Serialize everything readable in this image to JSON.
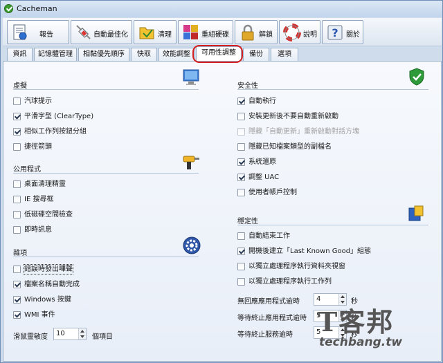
{
  "window": {
    "title": "Cacheman"
  },
  "toolbar": [
    {
      "label": "報告",
      "icon": "report-icon"
    },
    {
      "label": "自動最佳化",
      "icon": "syringe-icon"
    },
    {
      "label": "清理",
      "icon": "cleanup-icon"
    },
    {
      "label": "重組硬碟",
      "icon": "defrag-icon"
    },
    {
      "label": "解鎖",
      "icon": "padlock-icon"
    },
    {
      "label": "說明",
      "icon": "lifebuoy-icon"
    },
    {
      "label": "關於",
      "icon": "question-icon"
    }
  ],
  "tabs": [
    "資訊",
    "記憶體管理",
    "相黏優先順序",
    "快取",
    "效能調整",
    "可用性調整",
    "備份",
    "選項"
  ],
  "active_tab": "可用性調整",
  "left": {
    "appearance": {
      "title": "虛擬",
      "options": [
        {
          "label": "汽球提示",
          "checked": false
        },
        {
          "label": "平滑字型 (ClearType)",
          "checked": true
        },
        {
          "label": "相似工作列按鈕分組",
          "checked": true
        },
        {
          "label": "捷徑箭頭",
          "checked": false
        }
      ]
    },
    "utilities": {
      "title": "公用程式",
      "options": [
        {
          "label": "桌面清理精靈",
          "checked": false
        },
        {
          "label": "IE 搜尋框",
          "checked": false
        },
        {
          "label": "低磁碟空間檢查",
          "checked": false
        },
        {
          "label": "即時訊息",
          "checked": false
        }
      ]
    },
    "misc": {
      "title": "雜項",
      "options": [
        {
          "label": "錯誤時發出嗶聲",
          "checked": false
        },
        {
          "label": "檔案名稱自動完成",
          "checked": true
        },
        {
          "label": "Windows 按鍵",
          "checked": true
        },
        {
          "label": "WMI 事件",
          "checked": true
        }
      ],
      "mouse_label": "滑鼠靈敏度",
      "mouse_value": "10",
      "mouse_unit": "個項目"
    }
  },
  "right": {
    "security": {
      "title": "安全性",
      "options": [
        {
          "label": "自動執行",
          "checked": true
        },
        {
          "label": "安裝更新後不要自動重新啟動",
          "checked": false
        },
        {
          "label": "隱藏「自動更新」重新啟動對話方塊",
          "checked": false,
          "disabled": true
        },
        {
          "label": "隱藏已知檔案類型的副檔名",
          "checked": false
        },
        {
          "label": "系統還原",
          "checked": true
        },
        {
          "label": "調整 UAC",
          "checked": true
        },
        {
          "label": "使用者帳戶控制",
          "checked": false
        }
      ]
    },
    "stability": {
      "title": "穩定性",
      "options": [
        {
          "label": "自動結束工作",
          "checked": false
        },
        {
          "label": "開機後建立「Last Known Good」組態",
          "checked": true
        },
        {
          "label": "以獨立處理程序執行資料夾視窗",
          "checked": false
        },
        {
          "label": "以獨立處理程序執行工作列",
          "checked": false
        }
      ],
      "fields": [
        {
          "label": "無回應應用程式逾時",
          "value": "4",
          "unit": "秒"
        },
        {
          "label": "等待終止應用程式逾時",
          "value": "5",
          "unit": "秒"
        },
        {
          "label": "等待終止服務逾時",
          "value": "5",
          "unit": "秒"
        }
      ]
    }
  },
  "watermark": {
    "logo": "T客邦",
    "url": "techbang.tw"
  }
}
